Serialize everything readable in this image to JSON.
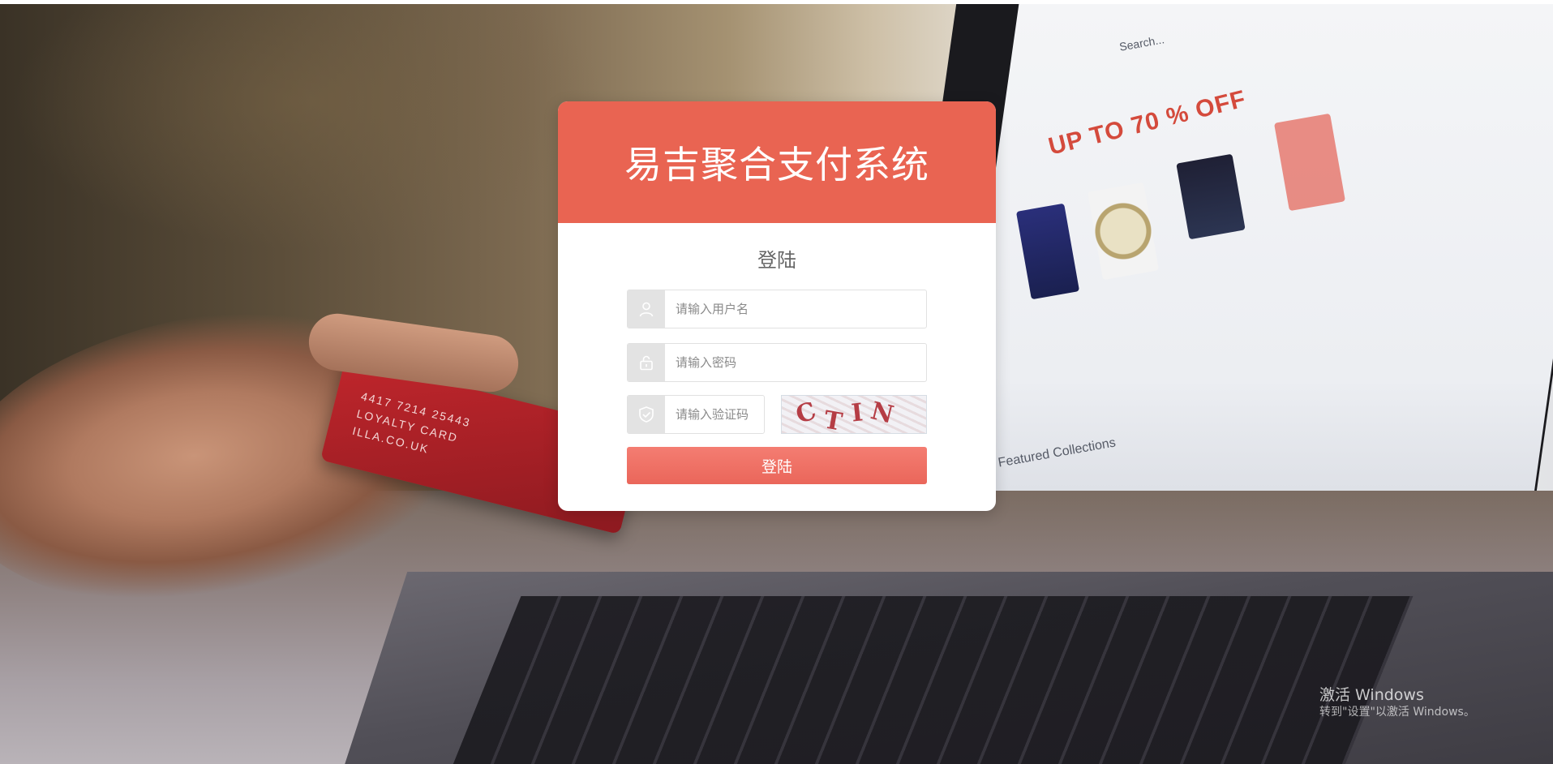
{
  "login": {
    "system_title": "易吉聚合支付系统",
    "form_title": "登陆",
    "username_placeholder": "请输入用户名",
    "password_placeholder": "请输入密码",
    "captcha_placeholder": "请输入验证码",
    "captcha_text": "CTIN",
    "submit_label": "登陆"
  },
  "icons": {
    "username": "user-icon",
    "password": "lock-icon",
    "captcha": "shield-check-icon"
  },
  "colors": {
    "header": "#e96452",
    "button": "#ea665a",
    "icon_bg": "#e3e3e3"
  },
  "background": {
    "card_text": "LOYALTY CARD",
    "card_number": "4417 7214 25443",
    "card_site": "ILLA.CO.UK",
    "screen_promo": "UP TO 70 % OFF",
    "screen_section": "Featured Collections",
    "screen_search": "Search..."
  },
  "watermark": {
    "title": "激活 Windows",
    "subtitle": "转到\"设置\"以激活 Windows。"
  }
}
